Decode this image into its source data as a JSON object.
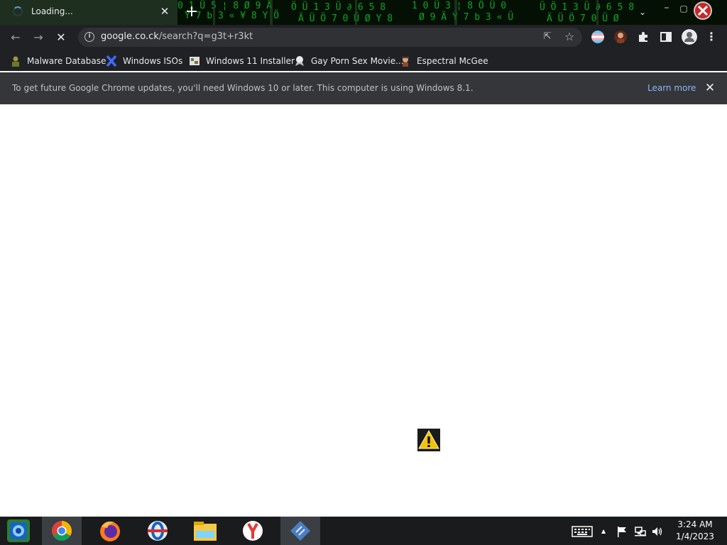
{
  "tab": {
    "title": "Loading...",
    "close": "✕"
  },
  "tabstrip": {
    "new_tab": "+",
    "tab_search": "⌄",
    "minimize": "–",
    "maximize": "▢"
  },
  "toolbar": {
    "back": "←",
    "forward": "→",
    "stop": "✕",
    "info": "i",
    "share": "⇱",
    "star": "☆",
    "menu": "⋮"
  },
  "omnibox": {
    "host": "google.co.ck",
    "path": "/search?q=g3t+r3kt"
  },
  "bookmarks": [
    {
      "label": "Malware Database",
      "icon": "person-icon"
    },
    {
      "label": "Windows ISOs",
      "icon": "x-icon"
    },
    {
      "label": "Windows 11 Installer",
      "icon": "picture-icon"
    },
    {
      "label": "Gay Porn Sex Movie...",
      "icon": "badge-icon"
    },
    {
      "label": "Espectral McGee",
      "icon": "character-icon"
    }
  ],
  "infobar": {
    "message": "To get future Google Chrome updates, you'll need Windows 10 or later. This computer is using Windows 8.1.",
    "learn_more": "Learn more",
    "close": "✕"
  },
  "taskbar": {
    "apps": [
      "start-icon",
      "chrome-icon",
      "firefox-icon",
      "opera-icon",
      "file-explorer-icon",
      "yandex-icon",
      "app-icon"
    ],
    "time": "3:24 AM",
    "date": "1/4/2023",
    "tray_up": "▲"
  },
  "colors": {
    "accent": "#8ab4f8",
    "toolbar": "#202124",
    "infobar": "#35363a",
    "matrix": "#00d000"
  }
}
